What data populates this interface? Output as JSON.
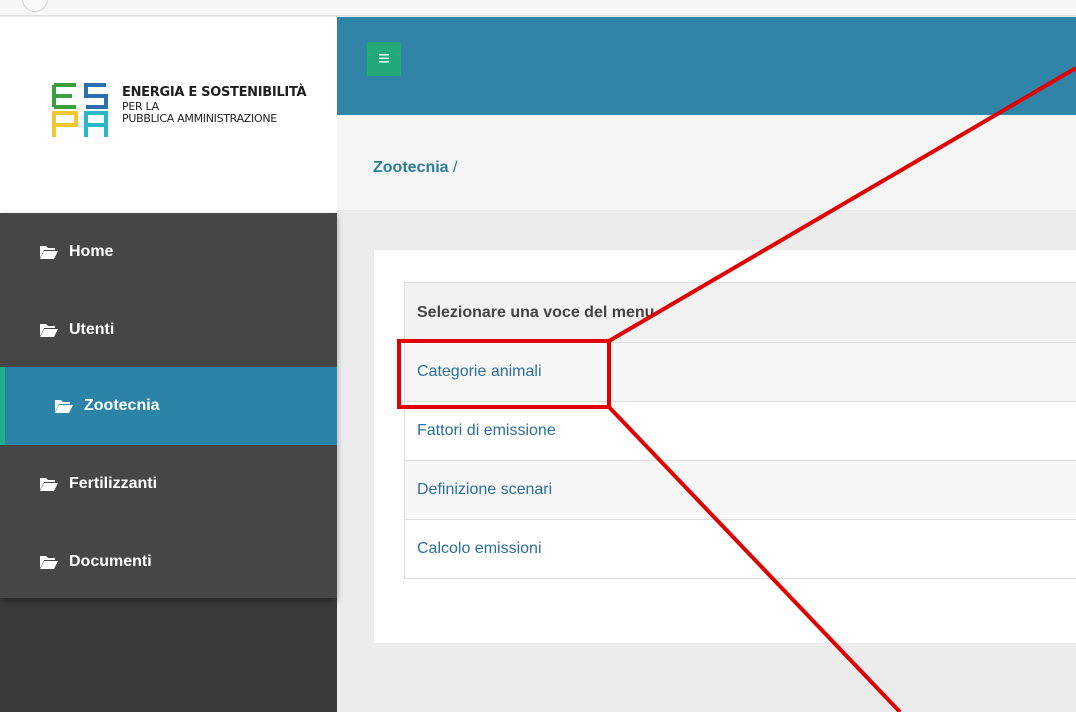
{
  "logo": {
    "line1": "ENERGIA E SOSTENIBILITÀ",
    "line2": "PER LA",
    "line3": "PUBBLICA AMMINISTRAZIONE",
    "colors": {
      "green": "#3aa13a",
      "blue": "#2b6fb0",
      "yellow": "#f2c830",
      "cyan": "#27b7c8"
    }
  },
  "header": {
    "menu_icon": "hamburger-icon",
    "menu_glyph": "≡"
  },
  "breadcrumb": {
    "current": "Zootecnia",
    "separator": " /"
  },
  "sidebar": {
    "items": [
      {
        "label": "Home",
        "icon": "folder-icon",
        "active": false
      },
      {
        "label": "Utenti",
        "icon": "folder-icon",
        "active": false
      },
      {
        "label": "Zootecnia",
        "icon": "folder-icon",
        "active": true
      },
      {
        "label": "Fertilizzanti",
        "icon": "folder-icon",
        "active": false
      },
      {
        "label": "Documenti",
        "icon": "folder-icon",
        "active": false
      }
    ]
  },
  "menu_table": {
    "header": "Selezionare una voce del menu",
    "items": [
      "Categorie animali",
      "Fattori di emissione",
      "Definizione scenari",
      "Calcolo emissioni"
    ]
  },
  "colors": {
    "header_bg": "#2f84a8",
    "menu_btn": "#23a877",
    "sidebar_bg": "#464646",
    "active_item": "#2c83a8",
    "active_border": "#1fae86",
    "link": "#2c6fa0",
    "annotation": "#e00000"
  }
}
